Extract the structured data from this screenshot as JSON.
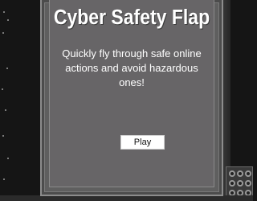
{
  "game": {
    "title": "Cyber Safety Flap",
    "description": "Quickly fly through safe online actions and avoid hazardous ones!",
    "play_label": "Play"
  },
  "colors": {
    "background": "#151515",
    "panel": "#676567",
    "panel_border": "#8c8c8c",
    "text": "#ffffff",
    "button": "#ffffff"
  }
}
